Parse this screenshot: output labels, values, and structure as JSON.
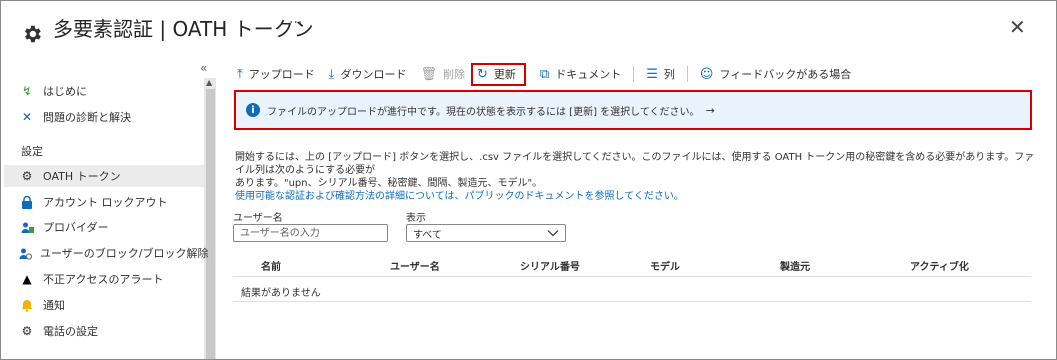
{
  "header": {
    "title": "多要素認証 | OATH トークン",
    "more": "···",
    "close": "✕"
  },
  "sidebar": {
    "collapse": "«",
    "items_top": [
      {
        "label": "はじめに",
        "icon": "lightning-icon"
      },
      {
        "label": "問題の診断と解決",
        "icon": "wrench-icon"
      }
    ],
    "section": "設定",
    "items": [
      {
        "label": "OATH トークン",
        "icon": "gear-icon",
        "active": true
      },
      {
        "label": "アカウント ロックアウト",
        "icon": "lock-icon"
      },
      {
        "label": "プロバイダー",
        "icon": "provider-icon"
      },
      {
        "label": "ユーザーのブロック/ブロック解除",
        "icon": "block-user-icon"
      },
      {
        "label": "不正アクセスのアラート",
        "icon": "warning-icon"
      },
      {
        "label": "通知",
        "icon": "bell-icon"
      },
      {
        "label": "電話の設定",
        "icon": "gear-icon"
      }
    ]
  },
  "toolbar": {
    "upload": "アップロード",
    "download": "ダウンロード",
    "delete": "削除",
    "refresh": "更新",
    "docs": "ドキュメント",
    "columns": "列",
    "feedback": "フィードバックがある場合"
  },
  "banner": {
    "text": "ファイルのアップロードが進行中です。現在の状態を表示するには [更新] を選択してください。",
    "arrow": "→"
  },
  "description": {
    "line1": "開始するには、上の [アップロード] ボタンを選択し、.csv ファイルを選択してください。このファイルには、使用する OATH トークン用の秘密鍵を含める必要があります。ファイル列は次のようにする必要が",
    "line2": "あります。\"upn、シリアル番号、秘密鍵、間隔、製造元、モデル\"。",
    "link": "使用可能な認証および確認方法の詳細については、パブリックのドキュメントを参照してください。"
  },
  "filters": {
    "username_label": "ユーザー名",
    "username_placeholder": "ユーザー名の入力",
    "username_value": "",
    "display_label": "表示",
    "display_value": "すべて"
  },
  "table": {
    "columns": [
      "名前",
      "ユーザー名",
      "シリアル番号",
      "モデル",
      "製造元",
      "アクティブ化"
    ],
    "empty": "結果がありません"
  },
  "colors": {
    "accent": "#0f6cbd",
    "highlight_border": "#d40000",
    "banner_bg": "#eaf3fc",
    "active_item_bg": "#ebebeb"
  }
}
